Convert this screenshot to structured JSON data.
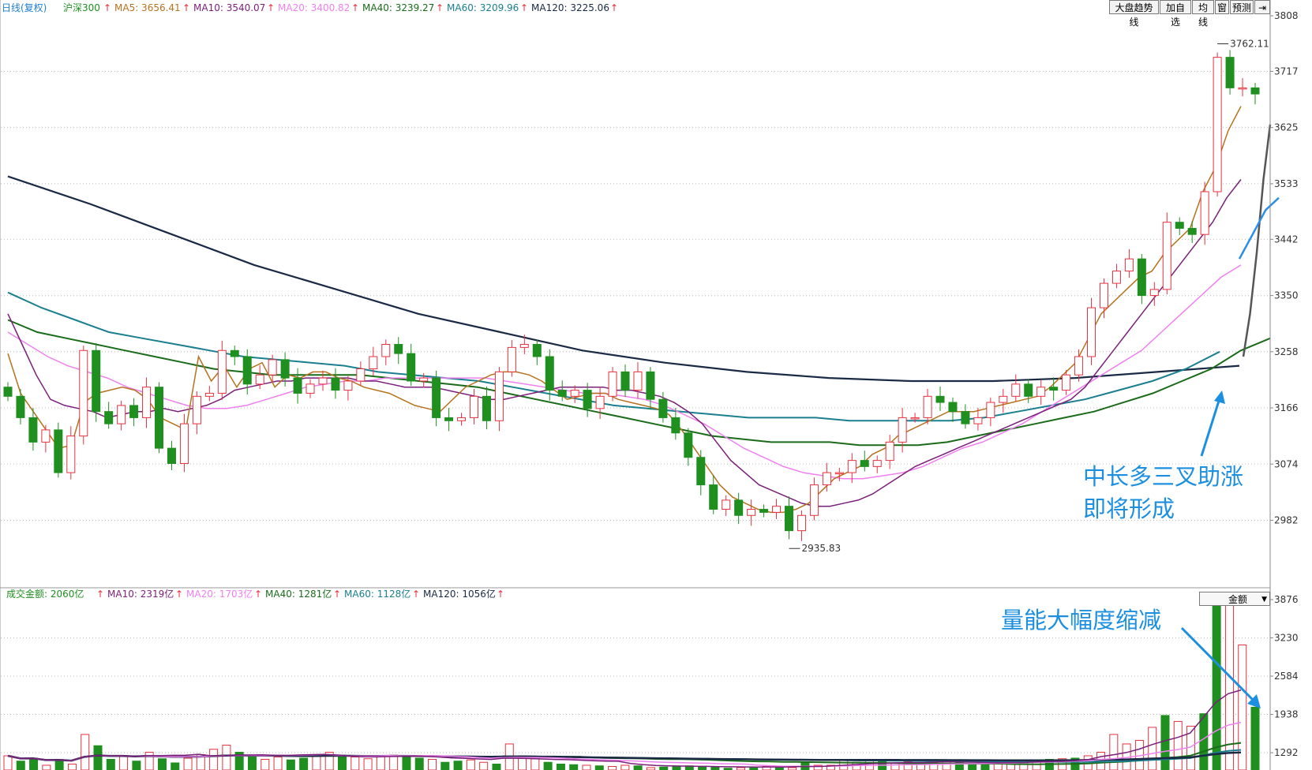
{
  "toolbar": {
    "trend_button": "大盘趋势线",
    "watchlist_button": "加自选",
    "avgline_button": "均线",
    "window_button": "窗",
    "forecast_button": "预测"
  },
  "volume_selector": {
    "value": "金额"
  },
  "annotations": {
    "price_line1": "中长多三叉助涨",
    "price_line2": "即将形成",
    "volume": "量能大幅度缩减"
  },
  "colors": {
    "up": "#e8313f",
    "down": "#1f8f1f",
    "ma5": "#b5731f",
    "ma10": "#7a1f7a",
    "ma20": "#f080f0",
    "ma40": "#1a6b1a",
    "ma60": "#1a7f8f",
    "ma120": "#1a2a45",
    "annotation": "#1d8fe0"
  },
  "chart_data": [
    {
      "type": "candlestick",
      "title": "日线(复权)",
      "symbol": "沪深300",
      "legend": [
        {
          "label": "MA5: 3656.41",
          "color": "#b5731f"
        },
        {
          "label": "MA10: 3540.07",
          "color": "#7a1f7a"
        },
        {
          "label": "MA20: 3400.82",
          "color": "#f080f0"
        },
        {
          "label": "MA40: 3239.27",
          "color": "#1a6b1a"
        },
        {
          "label": "MA60: 3209.96",
          "color": "#1a7f8f"
        },
        {
          "label": "MA120: 3225.06",
          "color": "#1a2a45"
        }
      ],
      "y_ticks": [
        3808,
        3717,
        3625,
        3533,
        3442,
        3350,
        3258,
        3166,
        3074,
        2982
      ],
      "ylim": [
        2878,
        3808
      ],
      "high_label": "3762.11",
      "low_label": "2935.83",
      "close": [
        3185,
        3150,
        3110,
        3130,
        3060,
        3120,
        3260,
        3160,
        3140,
        3170,
        3150,
        3200,
        3100,
        3075,
        3140,
        3185,
        3190,
        3260,
        3250,
        3205,
        3220,
        3245,
        3215,
        3190,
        3205,
        3215,
        3195,
        3210,
        3230,
        3250,
        3270,
        3255,
        3210,
        3215,
        3150,
        3145,
        3150,
        3185,
        3145,
        3225,
        3265,
        3270,
        3250,
        3195,
        3185,
        3195,
        3165,
        3185,
        3225,
        3195,
        3225,
        3180,
        3150,
        3125,
        3085,
        3040,
        3000,
        3015,
        2990,
        3000,
        2995,
        3005,
        2965,
        2990,
        3040,
        3060,
        3060,
        3080,
        3070,
        3080,
        3110,
        3150,
        3150,
        3185,
        3175,
        3160,
        3140,
        3150,
        3175,
        3185,
        3205,
        3185,
        3200,
        3195,
        3220,
        3250,
        3330,
        3370,
        3390,
        3410,
        3350,
        3360,
        3470,
        3460,
        3450,
        3520,
        3740,
        3690,
        3690,
        3680
      ],
      "ma5": [
        3255,
        3190,
        3160,
        3130,
        3100,
        3105,
        3175,
        3190,
        3195,
        3200,
        3195,
        3180,
        3150,
        3140,
        3130,
        3250,
        3210,
        3235,
        3200,
        3230,
        3240,
        3200,
        3220,
        3215,
        3225,
        3225,
        3215,
        3210,
        3200,
        3195,
        3190,
        3180,
        3170,
        3165,
        3160,
        3180,
        3200,
        3210,
        3220,
        3225,
        3225,
        3220,
        3210,
        3195,
        3180,
        3185,
        3190,
        3190,
        3180,
        3175,
        3170,
        3165,
        3155,
        3130,
        3100,
        3070,
        3040,
        3020,
        3010,
        3000,
        2995,
        2995,
        3000,
        3010,
        3030,
        3050,
        3060,
        3070,
        3090,
        3100,
        3120,
        3130,
        3140,
        3150,
        3160,
        3160,
        3160,
        3165,
        3170,
        3175,
        3180,
        3185,
        3200,
        3220,
        3240,
        3280,
        3320,
        3340,
        3360,
        3380,
        3390,
        3420,
        3440,
        3460,
        3520,
        3560,
        3620,
        3660
      ],
      "ma10": [
        3320,
        3270,
        3220,
        3180,
        3170,
        3165,
        3160,
        3150,
        3155,
        3160,
        3160,
        3165,
        3160,
        3165,
        3170,
        3180,
        3195,
        3200,
        3205,
        3210,
        3210,
        3215,
        3215,
        3215,
        3215,
        3210,
        3210,
        3205,
        3200,
        3200,
        3200,
        3195,
        3190,
        3185,
        3180,
        3180,
        3185,
        3190,
        3195,
        3200,
        3200,
        3200,
        3200,
        3195,
        3195,
        3190,
        3185,
        3175,
        3160,
        3140,
        3110,
        3080,
        3060,
        3040,
        3030,
        3020,
        3010,
        3005,
        3005,
        3010,
        3015,
        3025,
        3040,
        3055,
        3070,
        3080,
        3090,
        3100,
        3110,
        3120,
        3130,
        3140,
        3150,
        3160,
        3170,
        3180,
        3200,
        3230,
        3260,
        3290,
        3320,
        3350,
        3380,
        3410,
        3440,
        3470,
        3510,
        3540
      ],
      "ma20": [
        3290,
        3270,
        3250,
        3235,
        3225,
        3215,
        3200,
        3190,
        3180,
        3170,
        3165,
        3165,
        3170,
        3180,
        3190,
        3200,
        3205,
        3210,
        3210,
        3215,
        3215,
        3215,
        3215,
        3215,
        3215,
        3210,
        3205,
        3200,
        3195,
        3190,
        3190,
        3185,
        3180,
        3170,
        3155,
        3140,
        3120,
        3100,
        3085,
        3070,
        3060,
        3055,
        3050,
        3050,
        3055,
        3060,
        3070,
        3085,
        3100,
        3110,
        3125,
        3140,
        3160,
        3180,
        3200,
        3220,
        3240,
        3260,
        3290,
        3320,
        3350,
        3380,
        3400
      ],
      "ma40": [
        3310,
        3290,
        3280,
        3270,
        3260,
        3250,
        3240,
        3230,
        3225,
        3220,
        3220,
        3220,
        3220,
        3215,
        3210,
        3205,
        3200,
        3190,
        3180,
        3170,
        3160,
        3150,
        3140,
        3130,
        3120,
        3115,
        3110,
        3110,
        3110,
        3105,
        3105,
        3105,
        3110,
        3120,
        3130,
        3140,
        3150,
        3160,
        3175,
        3190,
        3210,
        3230,
        3260,
        3280
      ],
      "ma60": [
        3355,
        3330,
        3310,
        3290,
        3280,
        3270,
        3260,
        3250,
        3245,
        3240,
        3235,
        3225,
        3220,
        3215,
        3210,
        3200,
        3190,
        3180,
        3170,
        3165,
        3160,
        3155,
        3150,
        3150,
        3150,
        3145,
        3145,
        3145,
        3145,
        3150,
        3160,
        3170,
        3180,
        3195,
        3210,
        3230,
        3258
      ],
      "ma120": [
        3545,
        3500,
        3450,
        3400,
        3360,
        3320,
        3290,
        3260,
        3240,
        3225,
        3215,
        3210,
        3210,
        3215,
        3225,
        3235
      ],
      "gray_ext": [
        3250,
        3320,
        3420,
        3540,
        3630
      ],
      "blue_ext": [
        3410,
        3450,
        3490,
        3510
      ]
    },
    {
      "type": "bar",
      "title": "成交金额",
      "legend": [
        {
          "label": "成交金额: 2060亿",
          "color": "#1f8f1f"
        },
        {
          "label": "MA10: 2319亿",
          "color": "#7a1f7a"
        },
        {
          "label": "MA20: 1703亿",
          "color": "#f080f0"
        },
        {
          "label": "MA40: 1281亿",
          "color": "#1a6b1a"
        },
        {
          "label": "MA60: 1128亿",
          "color": "#1a7f8f"
        },
        {
          "label": "MA120: 1056亿",
          "color": "#1a2a45"
        }
      ],
      "y_ticks": [
        3876,
        3230,
        2584,
        1938,
        1292
      ],
      "ylim": [
        1000,
        3876
      ],
      "values": [
        1240,
        1150,
        1200,
        1080,
        1180,
        1100,
        1600,
        1410,
        1180,
        1240,
        1150,
        1300,
        1190,
        1120,
        1200,
        1260,
        1350,
        1420,
        1300,
        1240,
        1180,
        1220,
        1170,
        1200,
        1250,
        1300,
        1250,
        1220,
        1190,
        1230,
        1250,
        1240,
        1200,
        1180,
        1130,
        1150,
        1170,
        1130,
        1100,
        1440,
        1240,
        1190,
        1130,
        1100,
        1090,
        1080,
        1070,
        1060,
        1080,
        1070,
        1040,
        1050,
        1060,
        1070,
        1060,
        1050,
        1030,
        1040,
        1050,
        1060,
        1050,
        1040,
        1120,
        1080,
        1080,
        1170,
        1130,
        1180,
        1150,
        1120,
        1140,
        1100,
        1120,
        1160,
        1130,
        1110,
        1110,
        1120,
        1130,
        1140,
        1160,
        1180,
        1190,
        1200,
        1240,
        1300,
        1600,
        1440,
        1500,
        1720,
        1920,
        1820,
        1740,
        1950,
        3780,
        3900,
        3110,
        2060
      ]
    }
  ]
}
